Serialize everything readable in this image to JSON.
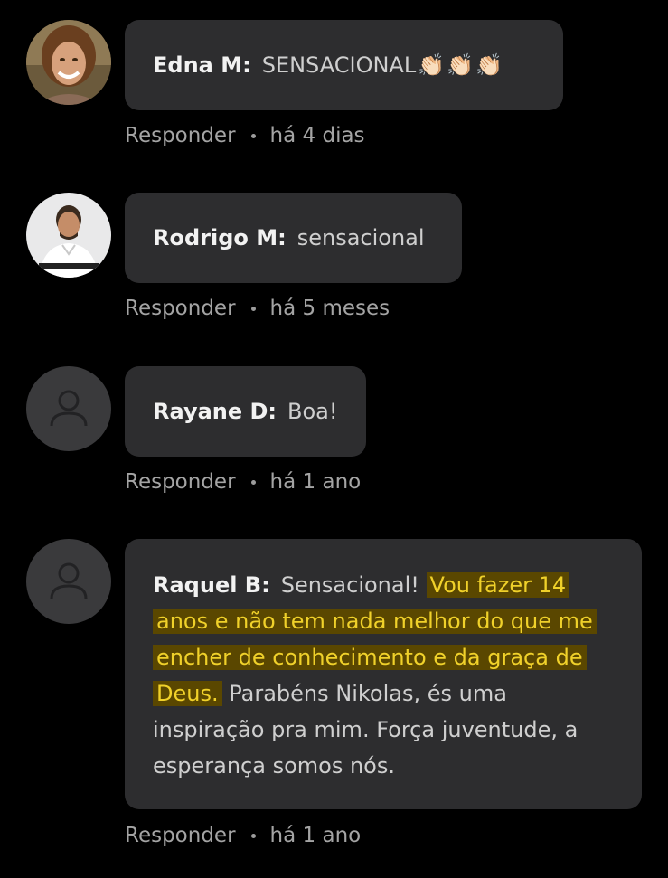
{
  "comments": [
    {
      "author": "Edna M:",
      "text": "SENSACIONAL",
      "emoji": "👏🏻👏🏻👏🏻",
      "reply_label": "Responder",
      "time": "há 4 dias",
      "avatar": "photo"
    },
    {
      "author": "Rodrigo M:",
      "text": "sensacional",
      "reply_label": "Responder",
      "time": "há 5 meses",
      "avatar": "photo"
    },
    {
      "author": "Rayane D:",
      "text": "Boa!",
      "reply_label": "Responder",
      "time": "há 1 ano",
      "avatar": "default-user-icon"
    },
    {
      "author": "Raquel B:",
      "text_before": "Sensacional!",
      "text_highlighted": "Vou fazer 14 anos e não tem nada melhor do que me encher de conhecimento e da graça de Deus.",
      "text_after": "Parabéns Nikolas, és uma inspiração pra mim. Força juventude, a esperança somos nós.",
      "reply_label": "Responder",
      "time": "há 1 ano",
      "avatar": "default-user-icon"
    }
  ],
  "colors": {
    "background": "#000000",
    "bubble": "#2d2d2f",
    "highlight_bg": "#5a4700",
    "highlight_text": "#f0d12a",
    "meta_text": "#9c9c9c"
  }
}
